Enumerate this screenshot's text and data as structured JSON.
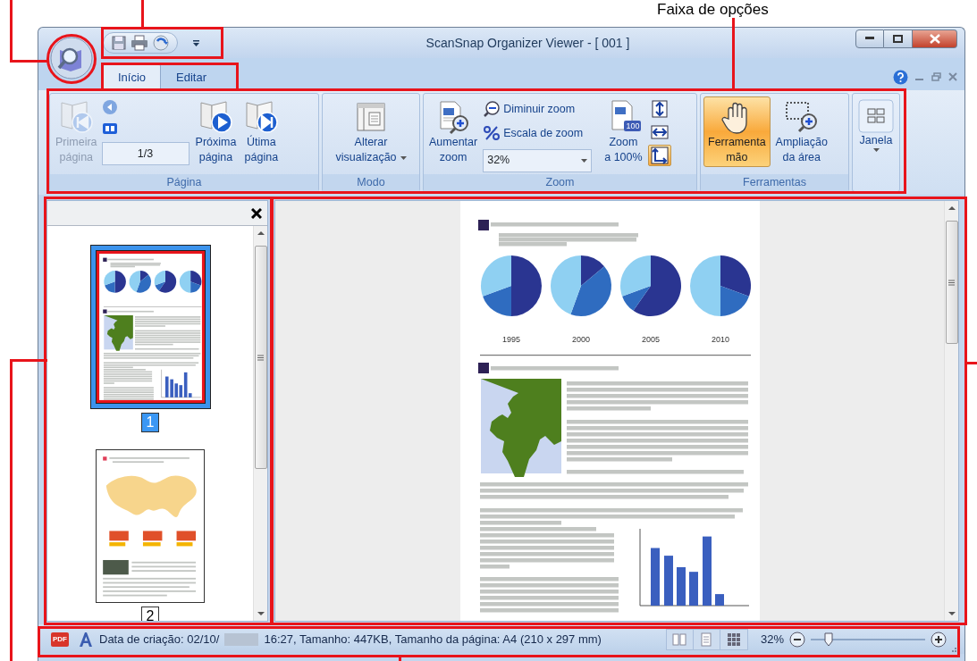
{
  "callout_label": "Faixa de opções",
  "window": {
    "title": "ScanSnap Organizer Viewer - [ 001 ]"
  },
  "tabs": [
    {
      "label": "Início",
      "selected": true
    },
    {
      "label": "Editar",
      "selected": false
    }
  ],
  "ribbon": {
    "page_group": {
      "label": "Página",
      "first": {
        "label": "Primeira\npágina",
        "disabled": true
      },
      "page_field": {
        "value": "1/3"
      },
      "next": {
        "label": "Próxima\npágina",
        "disabled": false
      },
      "last": {
        "label": "Útima\npágina",
        "disabled": false
      }
    },
    "mode_group": {
      "label": "Modo",
      "change_view": {
        "label": "Alterar\nvisualização"
      }
    },
    "zoom_group": {
      "label": "Zoom",
      "zoom_in": {
        "label": "Aumentar\nzoom"
      },
      "zoom_out": {
        "label": "Diminuir zoom"
      },
      "zoom_scale": {
        "label": "Escala de zoom"
      },
      "zoom_field": {
        "value": "32%"
      },
      "zoom_100": {
        "label": "Zoom\na 100%",
        "badge": "100"
      },
      "fit_buttons": [
        {
          "selected": false
        },
        {
          "selected": false
        },
        {
          "selected": true
        }
      ]
    },
    "tools_group": {
      "label": "Ferramentas",
      "hand": {
        "label": "Ferramenta\nmão",
        "selected": true
      },
      "area": {
        "label": "Ampliação\nda área",
        "selected": false
      }
    },
    "window_group": {
      "window_button": {
        "label": "Janela"
      }
    }
  },
  "thumbnails": {
    "pages": [
      {
        "number": "1",
        "selected": true
      },
      {
        "number": "2",
        "selected": false
      }
    ]
  },
  "viewer": {
    "year_labels": [
      "1995",
      "2000",
      "2005",
      "2010"
    ]
  },
  "status_bar": {
    "file_badge": "PDF",
    "info_start": "Data de criação: 02/10/",
    "info_end": "16:27, Tamanho: 447KB, Tamanho da página: A4 (210 x 297 mm)",
    "zoom": "32%",
    "zoom_slider": {
      "level": 0.16
    }
  }
}
